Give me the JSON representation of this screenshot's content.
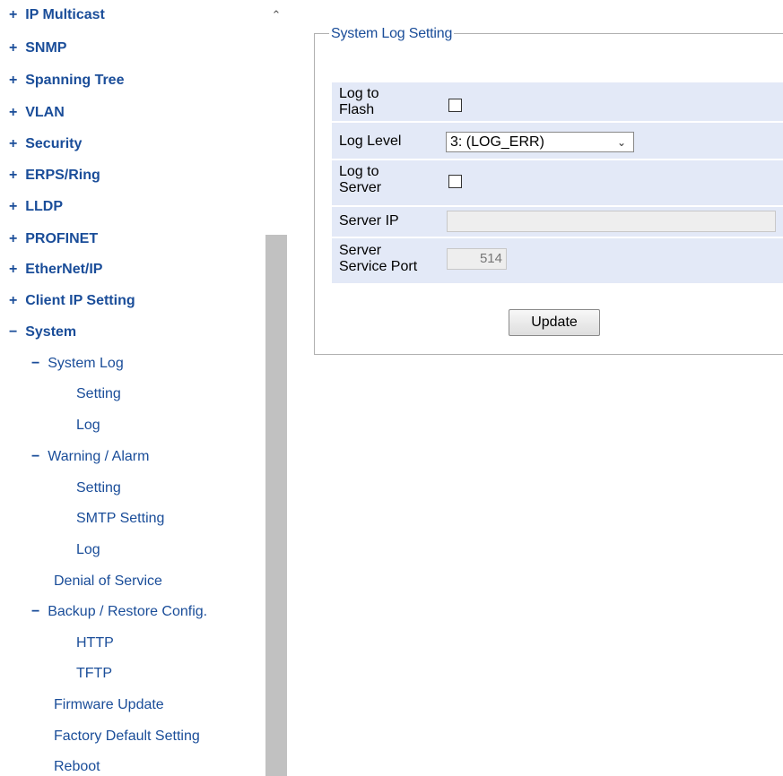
{
  "sidebar": {
    "items": [
      {
        "prefix": "+",
        "label": "IP Multicast"
      },
      {
        "prefix": "+",
        "label": "SNMP"
      },
      {
        "prefix": "+",
        "label": "Spanning Tree"
      },
      {
        "prefix": "+",
        "label": "VLAN"
      },
      {
        "prefix": "+",
        "label": "Security"
      },
      {
        "prefix": "+",
        "label": "ERPS/Ring"
      },
      {
        "prefix": "+",
        "label": "LLDP"
      },
      {
        "prefix": "+",
        "label": "PROFINET"
      },
      {
        "prefix": "+",
        "label": "EtherNet/IP"
      },
      {
        "prefix": "+",
        "label": "Client IP Setting"
      },
      {
        "prefix": "−",
        "label": "System"
      },
      {
        "prefix": "−",
        "label": "System Log"
      },
      {
        "prefix": "",
        "label": "Setting"
      },
      {
        "prefix": "",
        "label": "Log"
      },
      {
        "prefix": "−",
        "label": "Warning / Alarm"
      },
      {
        "prefix": "",
        "label": "Setting"
      },
      {
        "prefix": "",
        "label": "SMTP Setting"
      },
      {
        "prefix": "",
        "label": "Log"
      },
      {
        "prefix": "",
        "label": "Denial of Service"
      },
      {
        "prefix": "−",
        "label": "Backup / Restore Config."
      },
      {
        "prefix": "",
        "label": "HTTP"
      },
      {
        "prefix": "",
        "label": "TFTP"
      },
      {
        "prefix": "",
        "label": "Firmware Update"
      },
      {
        "prefix": "",
        "label": "Factory Default Setting"
      },
      {
        "prefix": "",
        "label": "Reboot"
      }
    ]
  },
  "scrollbar": {
    "up_icon": "chevron-up-icon"
  },
  "form": {
    "legend": "System Log Setting",
    "log_to_flash_label_1": "Log to",
    "log_to_flash_label_2": "Flash",
    "log_to_flash_checked": false,
    "log_level_label": "Log Level",
    "log_level_value": "3: (LOG_ERR)",
    "log_to_server_label_1": "Log to",
    "log_to_server_label_2": "Server",
    "log_to_server_checked": false,
    "server_ip_label": "Server IP",
    "server_ip_value": "",
    "server_port_label_1": "Server",
    "server_port_label_2": "Service Port",
    "server_port_value": "514",
    "update_label": "Update"
  },
  "colors": {
    "nav_link": "#1a4d99",
    "row_bg": "#e3e9f7",
    "scroll_thumb": "#c1c1c1"
  }
}
